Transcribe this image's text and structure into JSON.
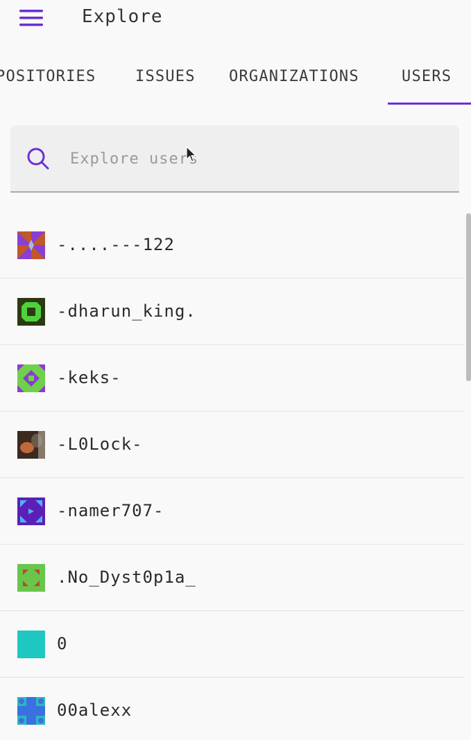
{
  "app": {
    "title": "Explore",
    "accent_color": "#6b2fd6",
    "menu_icon": "hamburger-menu-icon"
  },
  "tabs": [
    {
      "label": "POSITORIES",
      "selected": false
    },
    {
      "label": "ISSUES",
      "selected": false
    },
    {
      "label": "ORGANIZATIONS",
      "selected": false
    },
    {
      "label": "USERS",
      "selected": true
    }
  ],
  "search": {
    "placeholder": "Explore users",
    "value": "",
    "icon": "search-icon"
  },
  "users": [
    {
      "username": "-....---122",
      "avatar": "identicon-pinwheel",
      "avatar_colors": [
        "#8a3fd0",
        "#c0582a"
      ]
    },
    {
      "username": "-dharun_king.",
      "avatar": "identicon-ring",
      "avatar_colors": [
        "#2b3a12",
        "#4fd13a"
      ]
    },
    {
      "username": "-keks-",
      "avatar": "identicon-diamond",
      "avatar_colors": [
        "#8d3ad8",
        "#6fd04a"
      ]
    },
    {
      "username": "-L0Lock-",
      "avatar": "photo-avatar",
      "avatar_colors": [
        "#3b2a20",
        "#c06a3a"
      ]
    },
    {
      "username": "-namer707-",
      "avatar": "identicon-arrows",
      "avatar_colors": [
        "#5b1fb8",
        "#4fb2f0"
      ]
    },
    {
      "username": ".No_Dyst0p1a_",
      "avatar": "identicon-corners",
      "avatar_colors": [
        "#6ac64a",
        "#b44a3a"
      ]
    },
    {
      "username": "0",
      "avatar": "identicon-solid",
      "avatar_colors": [
        "#1ec8c0",
        "#1ec8c0"
      ]
    },
    {
      "username": "00alexx",
      "avatar": "identicon-cross",
      "avatar_colors": [
        "#3a70e0",
        "#2ab8c0"
      ]
    }
  ]
}
